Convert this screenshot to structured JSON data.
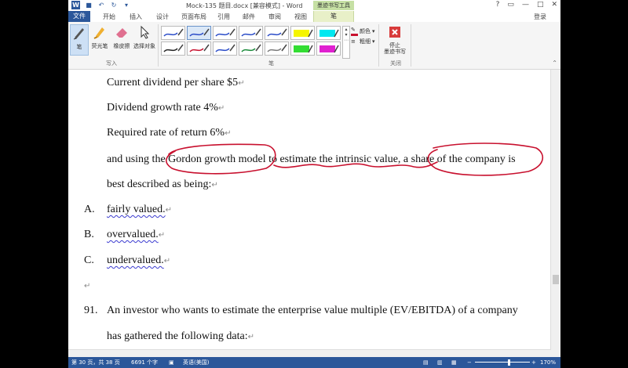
{
  "window": {
    "title": "Mock-135 题目.docx [兼容模式] - Word",
    "app_icon": "W",
    "controls": [
      "?",
      "▭",
      "—",
      "□",
      "✕"
    ]
  },
  "quick_access": [
    "save-icon",
    "undo-icon",
    "redo-icon"
  ],
  "tabs": {
    "file": "文件",
    "items": [
      "开始",
      "插入",
      "设计",
      "页面布局",
      "引用",
      "邮件",
      "审阅",
      "视图"
    ],
    "contextual_header": "墨迹书写工具",
    "active": "笔",
    "login": "登录"
  },
  "ribbon": {
    "write_group": {
      "label": "写入",
      "buttons": [
        "笔",
        "荧光笔",
        "橡皮擦",
        "选择对象"
      ]
    },
    "pen_group": {
      "label": "笔",
      "color_label": "颜色",
      "weight_label": "粗细",
      "swatch_colors": [
        "#2b4cc8",
        "#2b4cc8",
        "#2b4cc8",
        "#2b4cc8",
        "#2b4cc8",
        "#f5f500",
        "#00e8f0",
        "#222222",
        "#c8102e",
        "#2b4cc8",
        "#1a8a3a",
        "#7a7a7a",
        "#33dd33",
        "#e020d0"
      ]
    },
    "close_group": {
      "label": "关闭",
      "button": "停止\n墨迹书写"
    }
  },
  "document": {
    "lines": [
      {
        "text": "Current dividend per share $5",
        "mark": "↵"
      },
      {
        "text": "Dividend growth rate 4%",
        "mark": "↵"
      },
      {
        "text": "Required rate of return 6%",
        "mark": "↵"
      },
      {
        "text": "and using the Gordon growth model to estimate the intrinsic value, a share of the company is",
        "mark": ""
      },
      {
        "text": "best described as being:",
        "mark": "↵"
      }
    ],
    "options": [
      {
        "letter": "A.",
        "text": "fairly valued.",
        "mark": "↵"
      },
      {
        "letter": "B.",
        "text": "overvalued.",
        "mark": "↵"
      },
      {
        "letter": "C.",
        "text": "undervalued.",
        "mark": "↵"
      }
    ],
    "empty_mark": "↵",
    "question": {
      "number": "91.",
      "line1": "An investor who wants to estimate the enterprise value multiple (EV/EBITDA) of a company",
      "line2": "has gathered the following data:",
      "mark": "↵"
    },
    "ink_color": "#c8102e"
  },
  "status": {
    "page": "第 30 页，共 38 页",
    "words": "6691 个字",
    "language": "英语(美国)",
    "zoom": "170%"
  }
}
